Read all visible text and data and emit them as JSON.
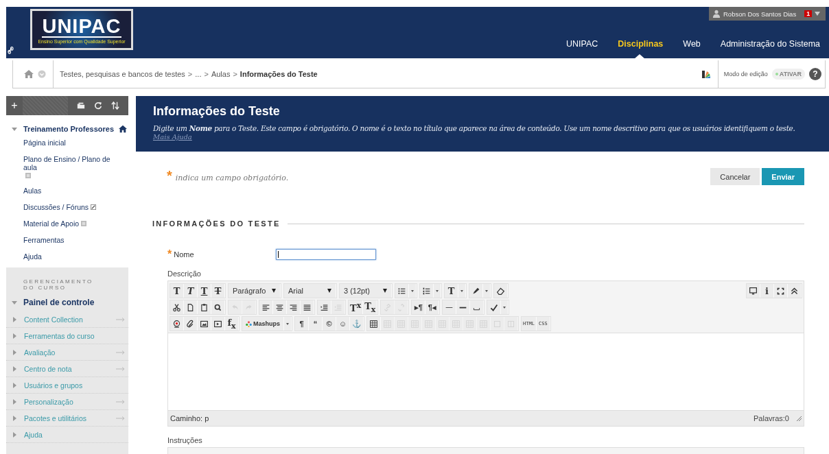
{
  "header": {
    "logo_title": "UNIPAC",
    "logo_subtitle": "Ensino Superior com Qualidade Superior",
    "user": {
      "name": "Robson Dos Santos Dias",
      "badge": "1"
    },
    "tabs": [
      {
        "label": "UNIPAC",
        "selected": false
      },
      {
        "label": "Disciplinas",
        "selected": true
      },
      {
        "label": "Web",
        "selected": false
      },
      {
        "label": "Administração do Sistema",
        "selected": false
      }
    ]
  },
  "breadcrumb": {
    "items": [
      {
        "label": "Testes, pesquisas e bancos de testes",
        "current": false
      },
      {
        "label": "...",
        "current": false
      },
      {
        "label": "Aulas",
        "current": false
      },
      {
        "label": "Informações do Teste",
        "current": true
      }
    ],
    "separator": ">",
    "edit_mode": {
      "label": "Modo de edição",
      "toggle": "ATIVAR",
      "on": false
    },
    "help": "?"
  },
  "sidebar": {
    "add": "+",
    "course": {
      "title": "Treinamento Professores",
      "expanded": true,
      "items": [
        {
          "label": "Página inicial",
          "kind": "plain"
        },
        {
          "label": "Plano de Ensino / Plano de aula",
          "kind": "page"
        },
        {
          "label": "Aulas",
          "kind": "plain"
        },
        {
          "label": "Discussões / Fóruns",
          "kind": "discussion"
        },
        {
          "label": "Material de Apoio",
          "kind": "page"
        },
        {
          "label": "Ferramentas",
          "kind": "plain"
        },
        {
          "label": "Ajuda",
          "kind": "plain"
        }
      ]
    },
    "management": {
      "heading": "GERENCIAMENTO DO CURSO",
      "panel": "Painel de controle",
      "expanded": true,
      "items": [
        {
          "label": "Content Collection",
          "arrow": true
        },
        {
          "label": "Ferramentas do curso",
          "arrow": false
        },
        {
          "label": "Avaliação",
          "arrow": true
        },
        {
          "label": "Centro de nota",
          "arrow": true
        },
        {
          "label": "Usuários e grupos",
          "arrow": false
        },
        {
          "label": "Personalização",
          "arrow": true
        },
        {
          "label": "Pacotes e utilitários",
          "arrow": true
        },
        {
          "label": "Ajuda",
          "arrow": false
        }
      ]
    }
  },
  "page": {
    "title": "Informações do Teste",
    "description": "Digite um **Nome** para o Teste. Este campo é obrigatório. O nome é o texto no título que aparece na área de conteúdo. Use um nome descritivo para que os usuários identifiquem o teste.",
    "help_link": "Mais Ajuda",
    "required_mark": "*",
    "required_note": "indica um campo obrigatório.",
    "buttons": [
      {
        "label": "Cancelar",
        "kind": "secondary"
      },
      {
        "label": "Enviar",
        "kind": "primary"
      }
    ],
    "section": "INFORMAÇÕES DO TESTE",
    "name_field": {
      "label": "Nome",
      "required": true,
      "focused": true
    },
    "description_label": "Descrição",
    "editor": {
      "rows": [
        {
          "groups": [
            [
              {
                "kind": "bold",
                "text": "T",
                "disabled": false
              },
              {
                "kind": "italic",
                "text": "T",
                "disabled": false
              },
              {
                "kind": "underline",
                "text": "T",
                "disabled": false
              },
              {
                "kind": "strike",
                "text": "T",
                "disabled": false
              }
            ],
            [
              {
                "kind": "select",
                "text": "Parágrafo",
                "disabled": false
              }
            ],
            [
              {
                "kind": "select",
                "text": "Arial",
                "disabled": false
              }
            ],
            [
              {
                "kind": "select",
                "text": "3 (12pt)",
                "disabled": false
              }
            ],
            [
              {
                "kind": "bullets",
                "split": true,
                "disabled": false
              }
            ],
            [
              {
                "kind": "numbers",
                "split": true,
                "disabled": false
              }
            ],
            [
              {
                "kind": "serif",
                "text": "T",
                "split": true,
                "disabled": false
              }
            ],
            [
              {
                "kind": "highlighter",
                "split": true,
                "disabled": false
              }
            ],
            [
              {
                "kind": "eraser",
                "disabled": false
              }
            ]
          ],
          "right": [
            {
              "kind": "monitor",
              "disabled": false
            },
            {
              "kind": "serif",
              "text": "i",
              "disabled": false
            },
            {
              "kind": "expand",
              "disabled": false
            },
            {
              "kind": "collapse",
              "disabled": false
            }
          ]
        },
        {
          "groups": [
            [
              {
                "kind": "cut",
                "disabled": false
              },
              {
                "kind": "page",
                "disabled": false
              },
              {
                "kind": "clipboard",
                "disabled": false
              },
              {
                "kind": "search",
                "disabled": false
              }
            ],
            [
              {
                "kind": "undo",
                "disabled": true
              },
              {
                "kind": "redo",
                "disabled": true
              }
            ],
            [
              {
                "kind": "align-left",
                "disabled": false
              },
              {
                "kind": "align-center",
                "disabled": false
              },
              {
                "kind": "align-right",
                "disabled": false
              },
              {
                "kind": "justify",
                "disabled": false
              }
            ],
            [
              {
                "kind": "indent",
                "disabled": false
              },
              {
                "kind": "outdent",
                "disabled": true
              }
            ],
            [
              {
                "kind": "serif",
                "text": "T$^{x}$",
                "disabled": false
              },
              {
                "kind": "serif",
                "text": "T$_{x}$",
                "disabled": false
              }
            ],
            [
              {
                "kind": "link",
                "disabled": true
              },
              {
                "kind": "unlink",
                "disabled": true
              }
            ],
            [
              {
                "kind": "glyph",
                "text": "▸¶",
                "disabled": false
              },
              {
                "kind": "glyph",
                "text": "¶◂",
                "disabled": false
              }
            ],
            [
              {
                "kind": "hr",
                "disabled": false
              },
              {
                "kind": "hr-thick",
                "disabled": false
              },
              {
                "kind": "space",
                "disabled": false
              }
            ],
            [
              {
                "kind": "spellcheck",
                "split": true,
                "disabled": false
              }
            ]
          ]
        },
        {
          "groups": [
            [
              {
                "kind": "record",
                "disabled": false
              },
              {
                "kind": "clip",
                "disabled": false
              },
              {
                "kind": "image",
                "disabled": false
              },
              {
                "kind": "media",
                "disabled": false
              },
              {
                "kind": "serif",
                "text": "f$_{x}$",
                "disabled": false
              }
            ],
            [
              {
                "kind": "mashups",
                "text": "Mashups",
                "split": true,
                "disabled": false
              }
            ],
            [
              {
                "kind": "glyph",
                "text": "¶",
                "disabled": false
              },
              {
                "kind": "glyph",
                "text": "“",
                "disabled": false
              },
              {
                "kind": "glyph",
                "text": "©",
                "disabled": false
              },
              {
                "kind": "glyph",
                "text": "☺",
                "disabled": false
              },
              {
                "kind": "glyph",
                "text": "⚓",
                "disabled": false
              }
            ],
            [
              {
                "kind": "table",
                "disabled": false
              },
              {
                "kind": "table",
                "disabled": true
              },
              {
                "kind": "table",
                "disabled": true
              },
              {
                "kind": "table",
                "disabled": true
              },
              {
                "kind": "table",
                "disabled": true
              },
              {
                "kind": "table",
                "disabled": true
              },
              {
                "kind": "table",
                "disabled": true
              },
              {
                "kind": "table",
                "disabled": true
              },
              {
                "kind": "table",
                "disabled": true
              },
              {
                "kind": "cell",
                "disabled": true
              },
              {
                "kind": "columns",
                "disabled": true
              }
            ],
            [
              {
                "kind": "tiny",
                "text": "HTML",
                "disabled": false
              },
              {
                "kind": "tiny",
                "text": "CSS",
                "disabled": false
              }
            ]
          ]
        }
      ],
      "path": "Caminho: p",
      "words": "Palavras:0"
    },
    "instructions_label": "Instruções"
  }
}
